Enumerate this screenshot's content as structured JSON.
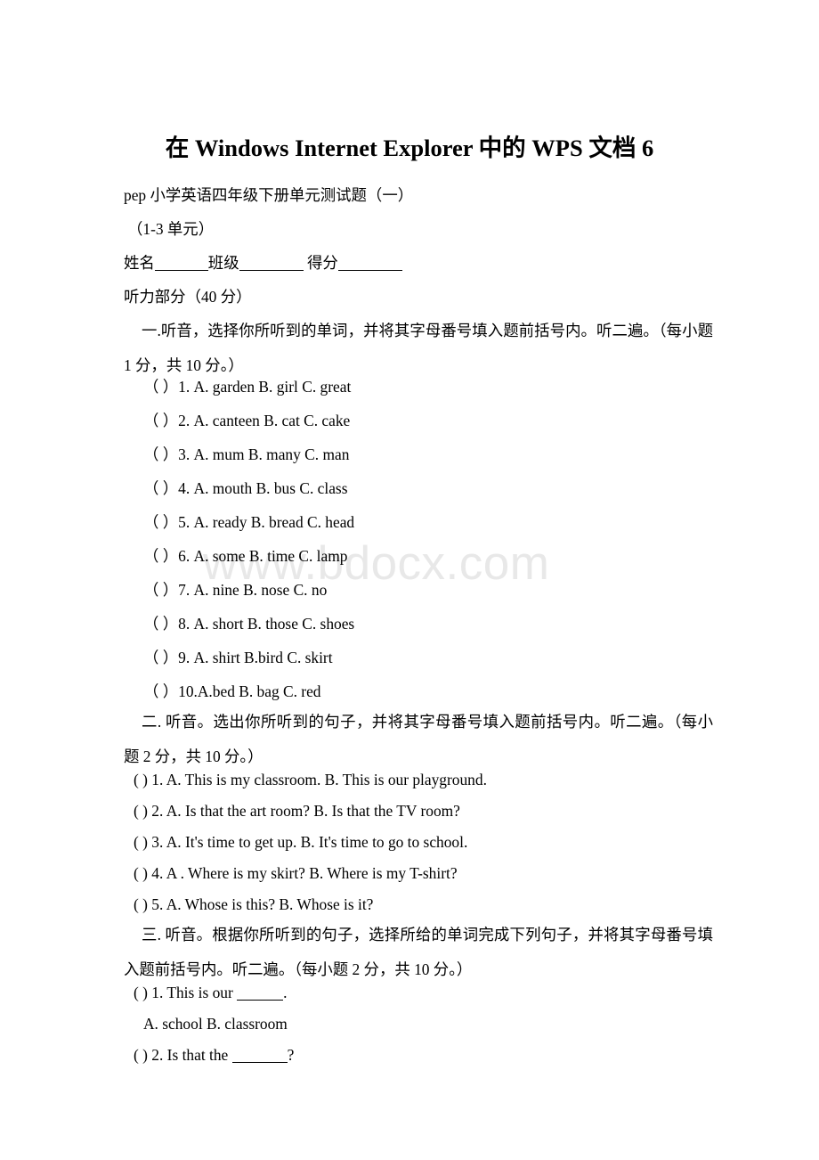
{
  "document": {
    "title": "在 Windows Internet Explorer 中的 WPS 文档 6",
    "watermark": "www.bdocx.com",
    "header_lines": [
      "pep 小学英语四年级下册单元测试题（一）",
      "（1-3 单元）"
    ],
    "name_line": {
      "name_label": "姓名",
      "class_label": "班级",
      "score_label": "得分"
    },
    "listening_section_label": "听力部分（40 分）",
    "sections": [
      {
        "id": "section-one",
        "instruction": "一.听音，选择你所听到的单词，并将其字母番号填入题前括号内。听二遍。（每小题 1 分，共 10 分。）",
        "items": [
          "（ ）1. A. garden B. girl C. great",
          "（ ）2. A. canteen B. cat C. cake",
          "（ ）3. A. mum B. many C. man",
          "（ ）4. A. mouth B. bus C. class",
          "（ ）5. A. ready B. bread C. head",
          "（ ）6. A. some B. time C. lamp",
          "（ ）7. A. nine B. nose C. no",
          "（ ）8. A. short B. those C. shoes",
          "（ ）9. A. shirt B.bird C. skirt",
          "（ ）10.A.bed B. bag C. red"
        ]
      },
      {
        "id": "section-two",
        "instruction": "二. 听音。选出你所听到的句子，并将其字母番号填入题前括号内。听二遍。（每小题 2 分，共 10 分。）",
        "items": [
          "( ) 1. A. This is my classroom. B. This is our playground.",
          "( ) 2. A. Is that the art room? B. Is that the TV room?",
          "( ) 3. A. It's time to get up. B. It's time to go to school.",
          "( ) 4. A . Where is my skirt? B. Where is my T-shirt?",
          "( ) 5. A. Whose is this? B. Whose is it?"
        ]
      },
      {
        "id": "section-three",
        "instruction": "三. 听音。根据你所听到的句子，选择所给的单词完成下列句子，并将其字母番号填入题前括号内。听二遍。（每小题 2 分，共 10 分。）",
        "items": [
          {
            "prefix": "( ) 1. This is our ",
            "suffix": "."
          },
          {
            "choices": "A. school B. classroom"
          },
          {
            "prefix": "( ) 2. Is that the ",
            "suffix": "?"
          }
        ]
      }
    ]
  }
}
